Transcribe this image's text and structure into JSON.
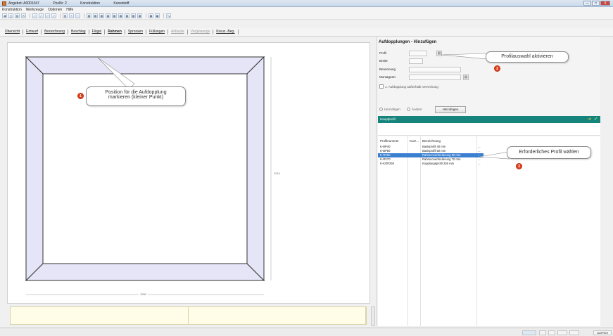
{
  "window": {
    "title_parts": [
      "Angebot: A0001047",
      "PosNr: 2",
      "Konstruktion",
      "Kunststoff"
    ],
    "buttons": [
      "—",
      "□",
      "X"
    ]
  },
  "menu": [
    "Konstruktion",
    "Werkzeuge",
    "Optionen",
    "Hilfe"
  ],
  "tabs": [
    {
      "label": "Übersicht",
      "state": "normal"
    },
    {
      "label": "Entwurf",
      "state": "normal"
    },
    {
      "label": "Bezeichnung",
      "state": "normal"
    },
    {
      "label": "Beschlag",
      "state": "normal"
    },
    {
      "label": "Flügel",
      "state": "normal"
    },
    {
      "label": "Rahmen",
      "state": "active"
    },
    {
      "label": "Sprossen",
      "state": "normal"
    },
    {
      "label": "Füllungen",
      "state": "normal"
    },
    {
      "label": "Anbaute",
      "state": "disabled"
    },
    {
      "label": "Verglasungs",
      "state": "disabled"
    },
    {
      "label": "Kreuz.-Beg.",
      "state": "normal"
    }
  ],
  "drawing": {
    "width_label": "1050",
    "height_label": "1014"
  },
  "callouts": {
    "one": {
      "number": "1",
      "text_line1": "Position für die Aufdopplung",
      "text_line2": "markieren (kleiner Punkt)"
    },
    "two": {
      "number": "2",
      "text": "Profilauswahl aktivieren"
    },
    "three": {
      "number": "3",
      "text": "Erforderliches Profil wählen"
    }
  },
  "panel": {
    "title": "Aufdopplungen - Hinzufügen",
    "labels": {
      "profil": "Profil",
      "breite": "Breite",
      "benennung": "Benennung",
      "montageart": "Montageart"
    },
    "checkbox_label": "1. Aufdopplung außerhalb Verrechung",
    "radio_add": "Hinzufügen",
    "radio_change": "Ändern",
    "add_button": "Hinzufügen",
    "teal_header": "Hauptprofil",
    "columns": [
      "Profilnummer",
      "Kurz...",
      "Bezeichnung"
    ],
    "rows": [
      {
        "nr": "K-BP40",
        "kurz": "",
        "bez": "Basisprofil 40 mm",
        "extra": "...",
        "selected": false
      },
      {
        "nr": "K-BP50",
        "kurz": "",
        "bez": "Basisprofil 50 mm",
        "extra": "...",
        "selected": false
      },
      {
        "nr": "K-RV50",
        "kurz": "",
        "bez": "Rahmenverbreiterung 50 mm",
        "extra": "...",
        "selected": true
      },
      {
        "nr": "K-RV70",
        "kurz": "",
        "bez": "Rahmenverbreiterung 70 mm",
        "extra": "...",
        "selected": false
      },
      {
        "nr": "K-KOP250",
        "kurz": "",
        "bez": "Kopplungsprofil 250 mm",
        "extra": "...",
        "selected": false
      }
    ]
  },
  "status": {
    "right_label": "AUFR25"
  },
  "colors": {
    "teal": "#16847c",
    "marker": "#e5401d",
    "frame_fill": "#e5e5f7",
    "selection": "#3a7fd0",
    "bottom_panel": "#fffde7"
  }
}
